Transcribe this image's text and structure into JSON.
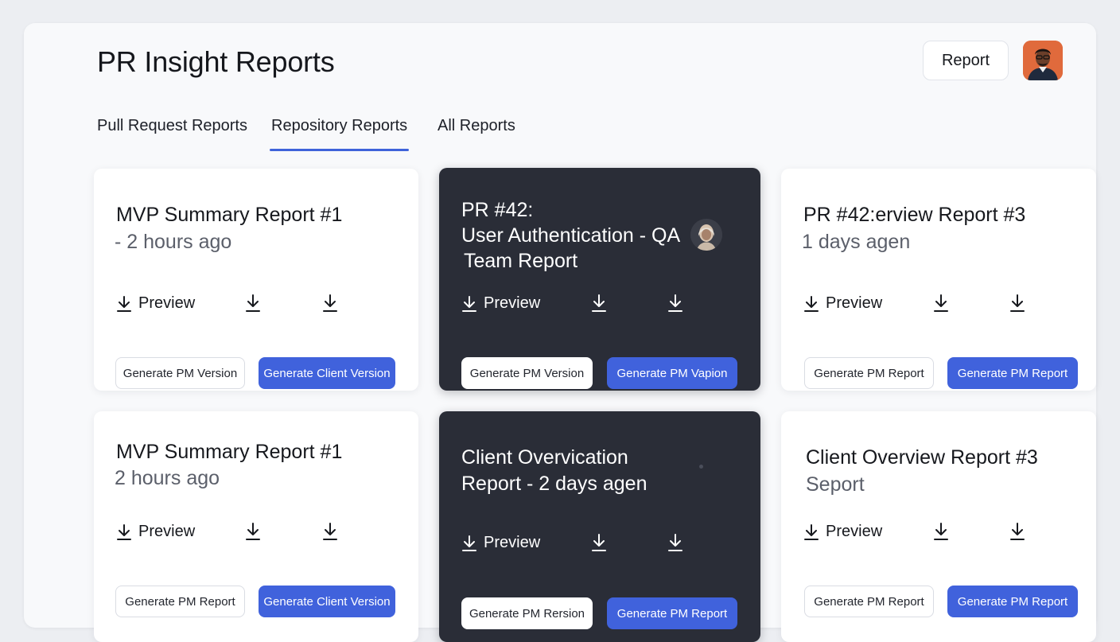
{
  "header": {
    "title": "PR Insight Reports",
    "report_button": "Report"
  },
  "tabs": [
    {
      "label": "Pull Request Reports",
      "active": false
    },
    {
      "label": "Repository Reports",
      "active": true
    },
    {
      "label": "All Reports",
      "active": false
    }
  ],
  "colors": {
    "accent": "#4062dc",
    "dark_card": "#2a2d37",
    "tab_underline": "#3f63da"
  },
  "cards": [
    {
      "title": "MVP Summary Report #1",
      "subtitle": "- 2 hours ago",
      "preview_label": "Preview",
      "button_outline": "Generate PM Version",
      "button_primary": "Generate Client Version"
    },
    {
      "title_lines": [
        "PR #42:",
        "User Authentication - QA",
        "Team Report"
      ],
      "preview_label": "Preview",
      "button_outline": "Generate PM Version",
      "button_primary": "Generate PM Vapion"
    },
    {
      "title": "PR #42:erview Report #3",
      "subtitle": "1 days agen",
      "preview_label": "Preview",
      "button_outline": "Generate PM Report",
      "button_primary": "Generate PM Report"
    },
    {
      "title": "MVP Summary Report #1",
      "subtitle": "2 hours ago",
      "preview_label": "Preview",
      "button_outline": "Generate PM Report",
      "button_primary": "Generate Client Version"
    },
    {
      "title_lines": [
        "Client Overvication",
        "Report - 2 days agen"
      ],
      "preview_label": "Preview",
      "button_outline": "Generate PM Rersion",
      "button_primary": "Generate PM Report"
    },
    {
      "title": "Client Overview Report #3",
      "subtitle": "Seport",
      "preview_label": "Preview",
      "button_outline": "Generate PM Report",
      "button_primary": "Generate PM Report"
    }
  ],
  "icons": {
    "download": "download-icon",
    "avatar": "user-avatar"
  }
}
